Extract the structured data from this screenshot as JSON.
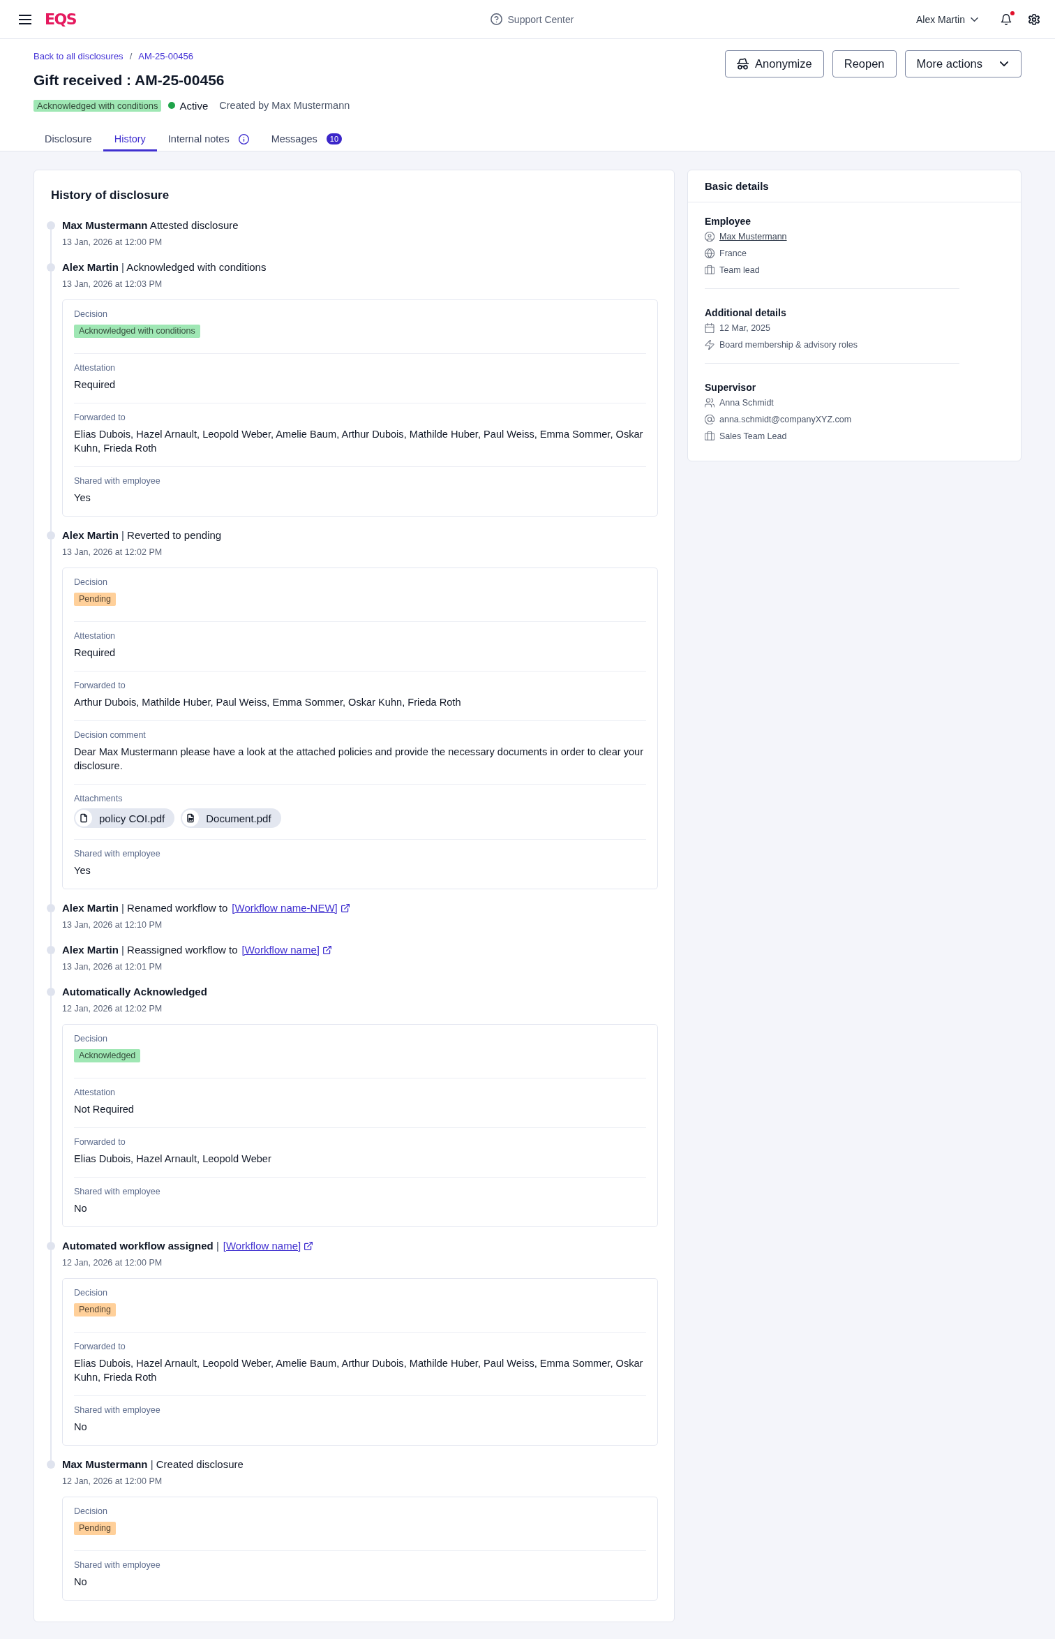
{
  "top_bar": {
    "logo": "EQS",
    "help": "Support Center",
    "user": "Alex Martin",
    "notifications_unread": true
  },
  "breadcrumb": {
    "items": [
      {
        "label": "Back to all disclosures"
      },
      {
        "label": "AM-25-00456"
      }
    ],
    "separator": "/"
  },
  "title": "Gift received : AM-25-00456",
  "status": {
    "badge": {
      "label": "Acknowledged with conditions",
      "color": "#9fe7b4"
    },
    "state": {
      "label": "Active",
      "color": "#1fa34a"
    },
    "created_by": "Created by Max Mustermann"
  },
  "actions": [
    {
      "label": "Anonymize",
      "kind": "icon"
    },
    {
      "label": "Reopen",
      "kind": "plain"
    },
    {
      "label": "More actions",
      "kind": "menu"
    }
  ],
  "tabs": [
    {
      "label": "Disclosure",
      "selected": false,
      "kind": "plain"
    },
    {
      "label": "History",
      "selected": true,
      "kind": "plain"
    },
    {
      "label": "Internal notes",
      "selected": false,
      "kind": "info"
    },
    {
      "label": "Messages",
      "selected": false,
      "kind": "count",
      "count": "10"
    }
  ],
  "history": {
    "title": "History of disclosure",
    "entries": [
      {
        "actor": "Max Mustermann",
        "action": "Attested disclosure",
        "date": "13 Jan, 2026 at 12:00 PM"
      },
      {
        "actor": "Alex Martin",
        "separator": "|",
        "action": "Acknowledged with conditions",
        "date": "13 Jan, 2026 at 12:03 PM",
        "details": [
          {
            "label": "Decision",
            "kind": "badge",
            "value": "Acknowledged with conditions",
            "color": "#9fe7b4"
          },
          {
            "label": "Attestation",
            "kind": "text",
            "value": "Required"
          },
          {
            "label": "Forwarded to",
            "kind": "text",
            "value": "Elias Dubois, Hazel Arnault, Leopold Weber, Amelie Baum, Arthur Dubois, Mathilde Huber, Paul Weiss, Emma Sommer, Oskar Kuhn, Frieda Roth"
          },
          {
            "label": "Shared with employee",
            "kind": "text",
            "value": "Yes"
          }
        ]
      },
      {
        "actor": "Alex Martin",
        "separator": "|",
        "action": "Reverted to pending",
        "date": "13 Jan, 2026 at 12:02 PM",
        "details": [
          {
            "label": "Decision",
            "kind": "badge",
            "value": "Pending",
            "color": "#ffd09a"
          },
          {
            "label": "Attestation",
            "kind": "text",
            "value": "Required"
          },
          {
            "label": "Forwarded to",
            "kind": "text",
            "value": "Arthur Dubois, Mathilde Huber, Paul Weiss, Emma Sommer, Oskar Kuhn, Frieda Roth"
          },
          {
            "label": "Decision comment",
            "kind": "text",
            "value": "Dear Max Mustermann please have a look at the attached policies and provide the necessary documents in order to clear your disclosure."
          },
          {
            "label": "Attachments",
            "kind": "files",
            "files": [
              {
                "name": "policy COI.pdf",
                "kind": "file"
              },
              {
                "name": "Document.pdf",
                "kind": "pdf"
              }
            ]
          },
          {
            "label": "Shared with employee",
            "kind": "text",
            "value": "Yes"
          }
        ]
      },
      {
        "actor": "Alex Martin",
        "separator": "|",
        "action": "Renamed workflow to",
        "link": "[Workflow name-NEW]",
        "date": "13 Jan, 2026 at 12:10 PM"
      },
      {
        "actor": "Alex Martin",
        "separator": "|",
        "action": "Reassigned workflow to",
        "link": "[Workflow name]",
        "date": "13 Jan, 2026 at 12:01 PM"
      },
      {
        "actor": "Automatically Acknowledged",
        "date": "12 Jan, 2026 at 12:02 PM",
        "details": [
          {
            "label": "Decision",
            "kind": "badge",
            "value": "Acknowledged",
            "color": "#9fe7b4"
          },
          {
            "label": "Attestation",
            "kind": "text",
            "value": "Not Required"
          },
          {
            "label": "Forwarded to",
            "kind": "text",
            "value": "Elias Dubois, Hazel Arnault, Leopold Weber"
          },
          {
            "label": "Shared with employee",
            "kind": "text",
            "value": "No"
          }
        ]
      },
      {
        "actor": "Automated workflow assigned",
        "separator": "|",
        "link": "[Workflow name]",
        "date": "12 Jan, 2026 at 12:00 PM",
        "details": [
          {
            "label": "Decision",
            "kind": "badge",
            "value": "Pending",
            "color": "#ffd09a"
          },
          {
            "label": "Forwarded to",
            "kind": "text",
            "value": "Elias Dubois, Hazel Arnault, Leopold Weber, Amelie Baum, Arthur Dubois, Mathilde Huber, Paul Weiss, Emma Sommer, Oskar Kuhn, Frieda Roth"
          },
          {
            "label": "Shared with employee",
            "kind": "text",
            "value": "No"
          }
        ]
      },
      {
        "actor": "Max Mustermann",
        "separator": "|",
        "action": "Created disclosure",
        "date": "12 Jan, 2026 at 12:00 PM",
        "details": [
          {
            "label": "Decision",
            "kind": "badge",
            "value": "Pending",
            "color": "#ffd09a"
          },
          {
            "label": "Shared with employee",
            "kind": "text",
            "value": "No"
          }
        ]
      }
    ]
  },
  "basic_details": {
    "title": "Basic details",
    "sections": [
      {
        "title": "Employee",
        "items": [
          {
            "kind": "person",
            "text": "Max Mustermann",
            "link": true
          },
          {
            "kind": "country",
            "text": "France"
          },
          {
            "kind": "role",
            "text": "Team lead"
          }
        ]
      },
      {
        "title": "Additional details",
        "items": [
          {
            "kind": "date",
            "text": "12 Mar, 2025"
          },
          {
            "kind": "category",
            "text": "Board membership & advisory roles"
          }
        ]
      },
      {
        "title": "Supervisor",
        "items": [
          {
            "kind": "supervisor",
            "text": "Anna Schmidt"
          },
          {
            "kind": "email",
            "text": "anna.schmidt@companyXYZ.com"
          },
          {
            "kind": "role",
            "text": "Sales Team Lead"
          }
        ]
      }
    ]
  }
}
